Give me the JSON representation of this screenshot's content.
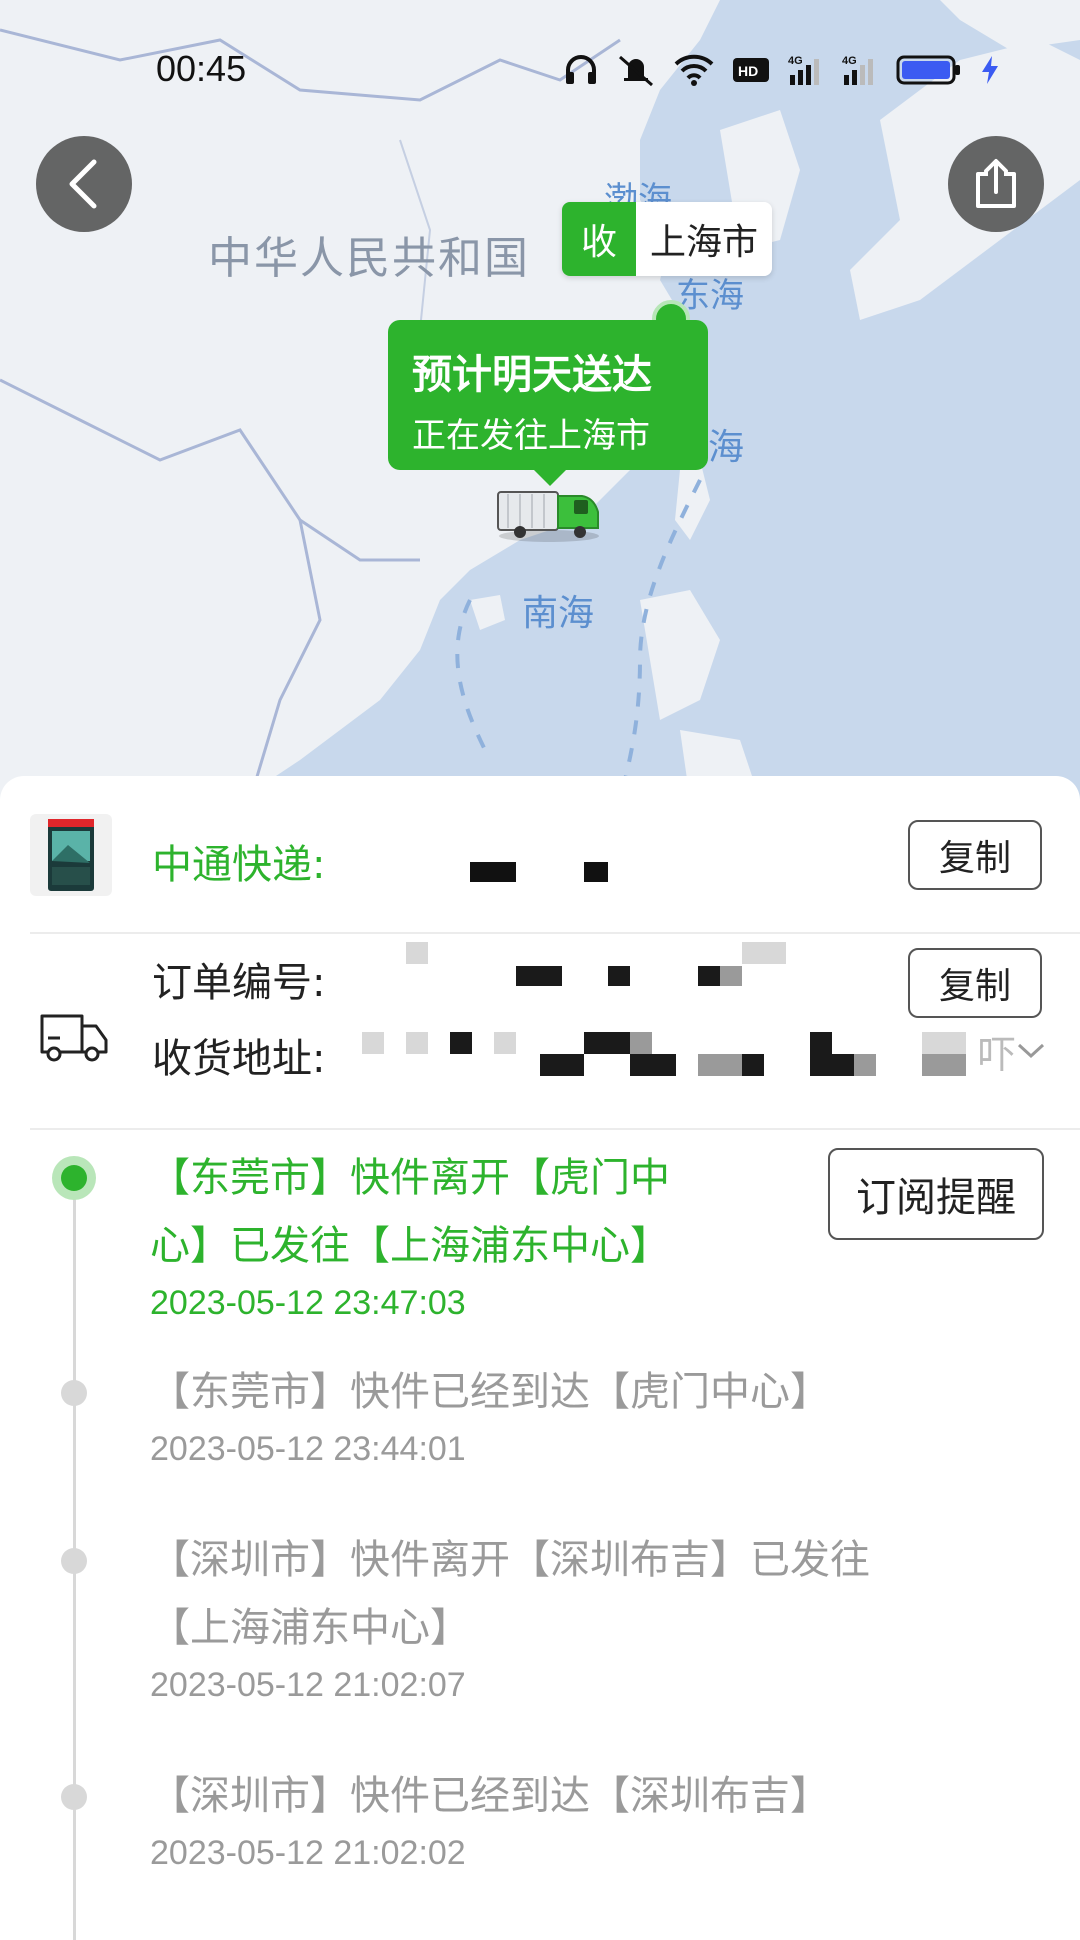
{
  "status_bar": {
    "time": "00:45",
    "icons": [
      "headphones-icon",
      "mute-icon",
      "wifi-icon",
      "hd-icon",
      "signal-4g-icon",
      "signal-4g-icon",
      "battery-icon",
      "charging-icon"
    ]
  },
  "map": {
    "country_label": "中华人民共和国",
    "seas": {
      "bohai": "渤海",
      "east": "东海",
      "taiwan": "海",
      "south": "南海"
    },
    "destination": {
      "tag": "收",
      "city": "上海市"
    },
    "status_bubble": {
      "title": "预计明天送达",
      "subtitle": "正在发往上海市"
    },
    "back_icon": "back-icon",
    "share_icon": "share-icon"
  },
  "courier": {
    "name": "中通快递:",
    "copy_label": "复制"
  },
  "order": {
    "order_label": "订单编号:",
    "address_label": "收货地址:",
    "copy_label": "复制",
    "address_tail": "吓"
  },
  "timeline": {
    "subscribe_label": "订阅提醒",
    "events": [
      {
        "text": "【东莞市】快件离开【虎门中心】已发往【上海浦东中心】",
        "line1": "【东莞市】快件离开【虎门中",
        "line2": "心】已发往【上海浦东中心】",
        "time": "2023-05-12 23:47:03"
      },
      {
        "text": "【东莞市】快件已经到达【虎门中心】",
        "time": "2023-05-12 23:44:01"
      },
      {
        "text": "【深圳市】快件离开【深圳布吉】已发往【上海浦东中心】",
        "line1": "【深圳市】快件离开【深圳布吉】已发往",
        "line2": "【上海浦东中心】",
        "time": "2023-05-12 21:02:07"
      },
      {
        "text": "【深圳市】快件已经到达【深圳布吉】",
        "time": "2023-05-12 21:02:02"
      }
    ]
  },
  "colors": {
    "accent": "#2db32d",
    "map_water": "#c8d8ec",
    "map_land": "#eef1f5",
    "muted_text": "#9a9a9a"
  }
}
